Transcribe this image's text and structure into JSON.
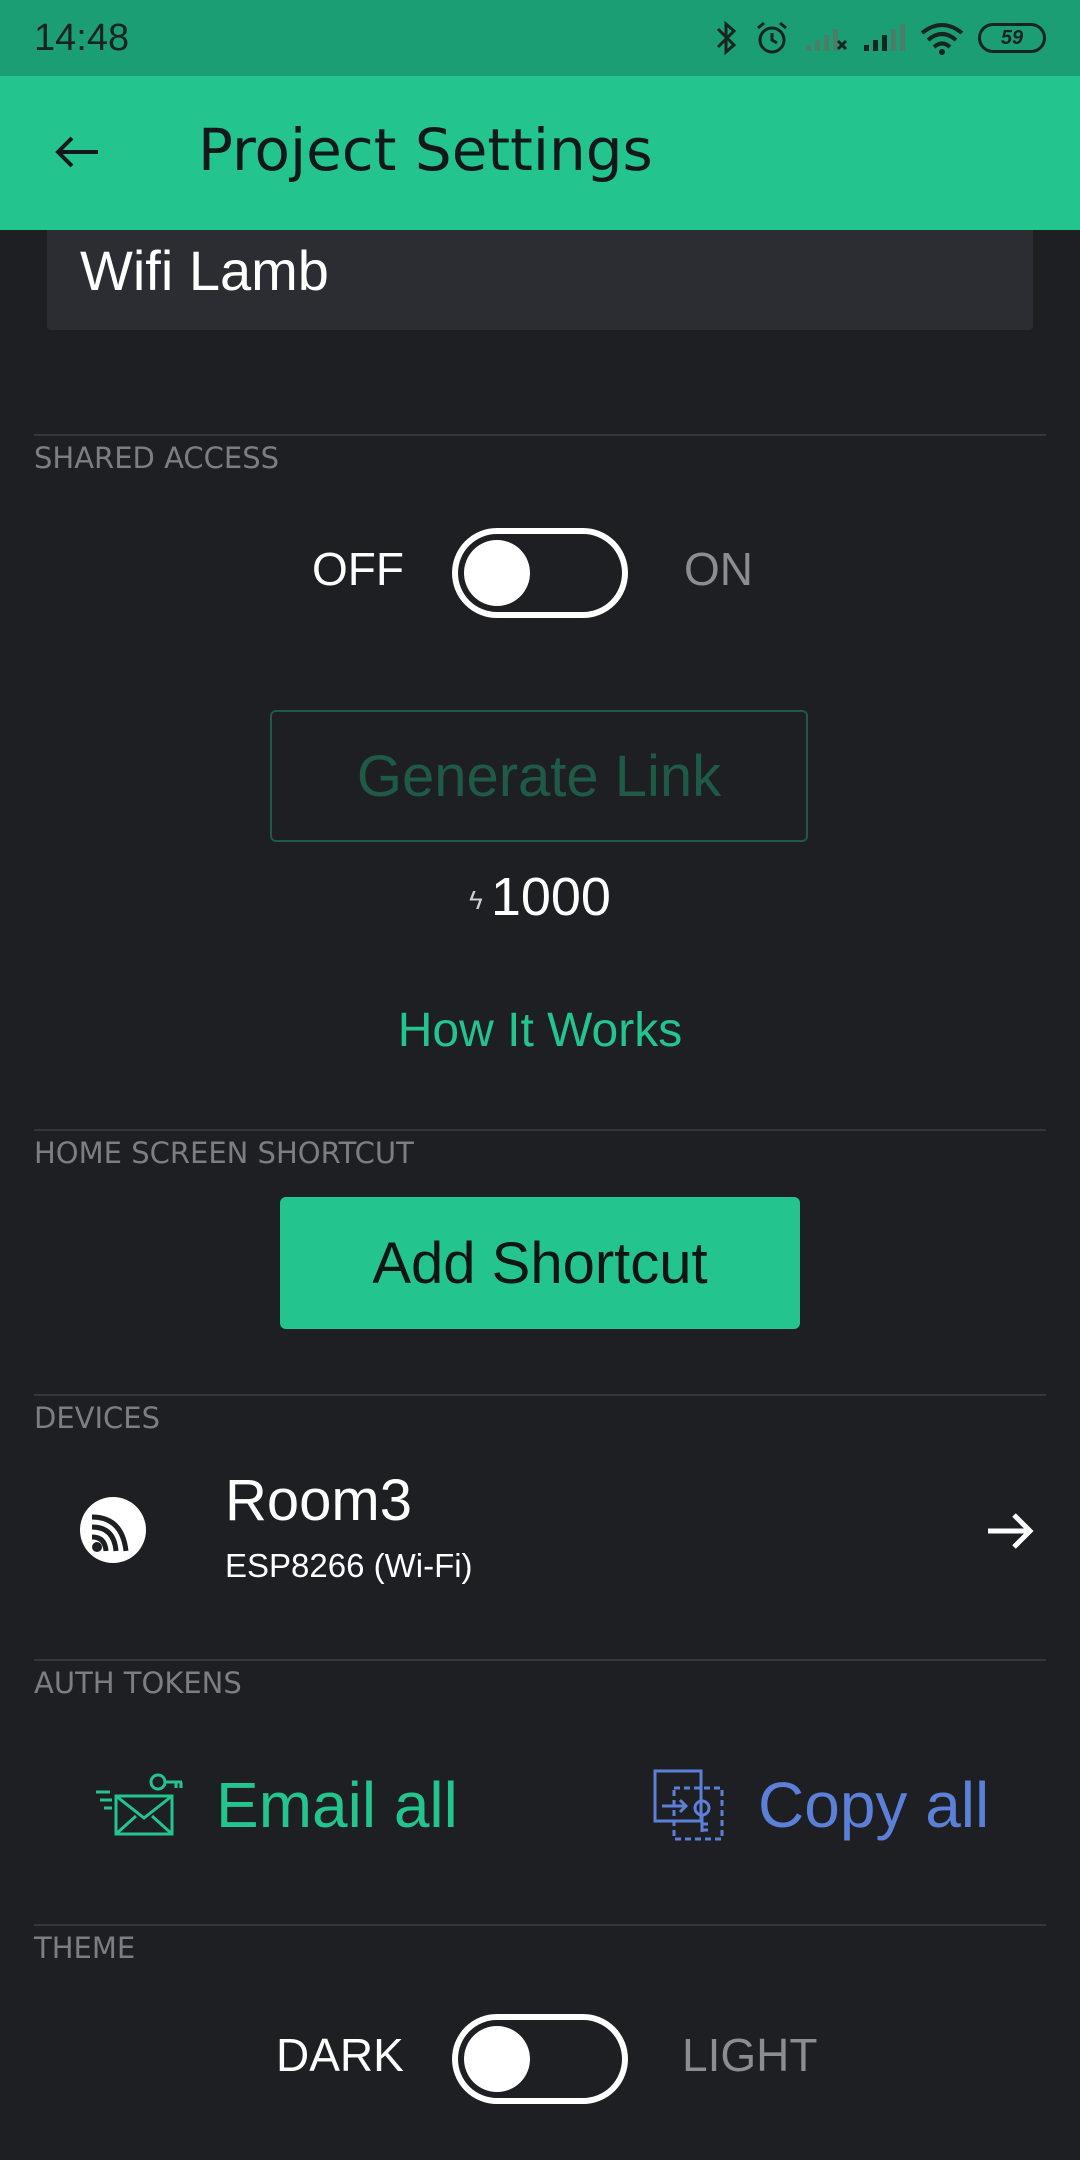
{
  "status_bar": {
    "time": "14:48",
    "battery": "59",
    "icons": [
      "bluetooth-icon",
      "alarm-icon",
      "signal-icon",
      "signal-icon",
      "wifi-icon",
      "battery-icon"
    ]
  },
  "app_bar": {
    "title": "Project Settings",
    "back_icon": "back-arrow-icon"
  },
  "project": {
    "name": "Wifi Lamb"
  },
  "shared_access": {
    "section_label": "SHARED ACCESS",
    "off_label": "OFF",
    "on_label": "ON",
    "enabled": false,
    "generate_link_label": "Generate Link",
    "energy_cost": "1000",
    "how_it_works_label": "How It Works"
  },
  "home_screen_shortcut": {
    "section_label": "HOME SCREEN SHORTCUT",
    "add_shortcut_label": "Add Shortcut"
  },
  "devices": {
    "section_label": "DEVICES",
    "items": [
      {
        "name": "Room3",
        "type": "ESP8266 (Wi-Fi)",
        "icon": "esp-wifi-icon"
      }
    ]
  },
  "auth_tokens": {
    "section_label": "AUTH TOKENS",
    "email_all_label": "Email all",
    "copy_all_label": "Copy all"
  },
  "theme": {
    "section_label": "THEME",
    "dark_label": "DARK",
    "light_label": "LIGHT",
    "selected": "DARK"
  },
  "colors": {
    "accent": "#23c48e",
    "status_bar": "#1b9e73",
    "background": "#1e1f23",
    "copy_blue": "#5c7fd8"
  }
}
